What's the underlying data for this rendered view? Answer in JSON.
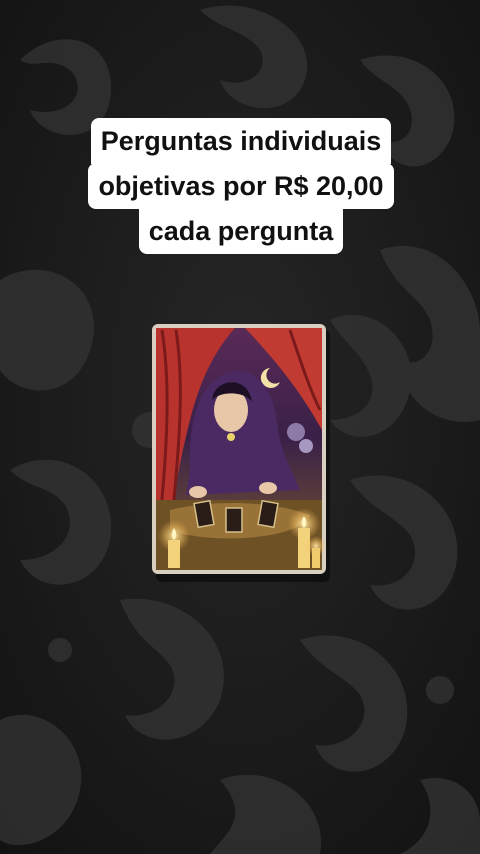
{
  "caption": {
    "line1": "Perguntas individuais",
    "line2": "objetivas por R$ 20,00",
    "line3": "cada pergunta"
  },
  "scene": {
    "background": "dark damask fabric",
    "object": "tarot card with fortune teller illustration",
    "colors": {
      "fabric_dark": "#161616",
      "fabric_pattern": "#2f2f2f",
      "curtain": "#b8322e",
      "cloak": "#4b2a63",
      "candle": "#f2d27a"
    }
  }
}
